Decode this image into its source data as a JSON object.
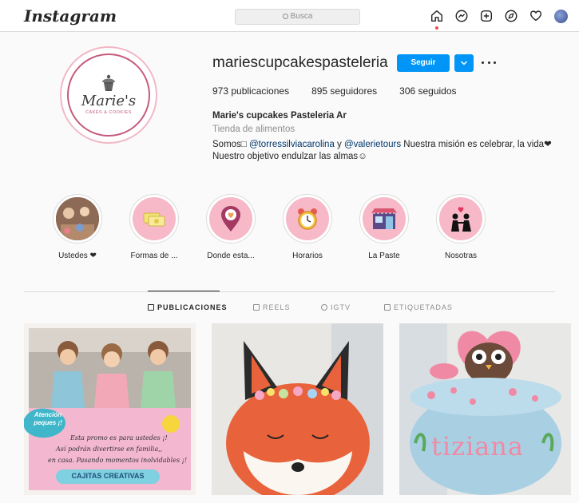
{
  "header": {
    "logo": "Instagram",
    "search_placeholder": "Busca"
  },
  "nav": {
    "icons": [
      "home-icon",
      "messenger-icon",
      "new-post-icon",
      "explore-icon",
      "activity-heart-icon",
      "profile-avatar"
    ]
  },
  "profile": {
    "avatar_brand": "Marie's",
    "avatar_sub": "CAKES & COOKIES",
    "username": "mariescupcakespasteleria",
    "follow_label": "Seguir",
    "posts": "973 publicaciones",
    "followers": "895 seguidores",
    "following": "306 seguidos",
    "full_name": "Marie's cupcakes Pasteleria Ar",
    "category": "Tienda de alimentos",
    "bio_prefix": "Somos□ ",
    "mention1": "@torressilviacarolina",
    "bio_and": " y ",
    "mention2": "@valerietours",
    "bio_suffix": " Nuestra misión es celebrar, la vida❤",
    "bio_line2": "Nuestro objetivo endulzar las almas☺",
    "accent": "#0095f6"
  },
  "highlights": [
    {
      "label": "Ustedes ❤"
    },
    {
      "label": "Formas de ..."
    },
    {
      "label": "Donde esta..."
    },
    {
      "label": "Horarios"
    },
    {
      "label": "La Paste"
    },
    {
      "label": "Nosotras"
    }
  ],
  "tabs": [
    {
      "label": "PUBLICACIONES",
      "active": true
    },
    {
      "label": "REELS",
      "active": false
    },
    {
      "label": "IGTV",
      "active": false
    },
    {
      "label": "ETIQUETADAS",
      "active": false
    }
  ],
  "posts": {
    "post1": {
      "badge": "Atención peques ¡!",
      "line1": "Esta promo es para ustedes ¡!",
      "line2": "Así podrán divertirse en familia,,",
      "line3": "en casa. Pasando momentos inolvidables ¡!",
      "cta": "CAJITAS CREATIVAS"
    },
    "post3": {
      "cake_text": "tiziana"
    }
  }
}
